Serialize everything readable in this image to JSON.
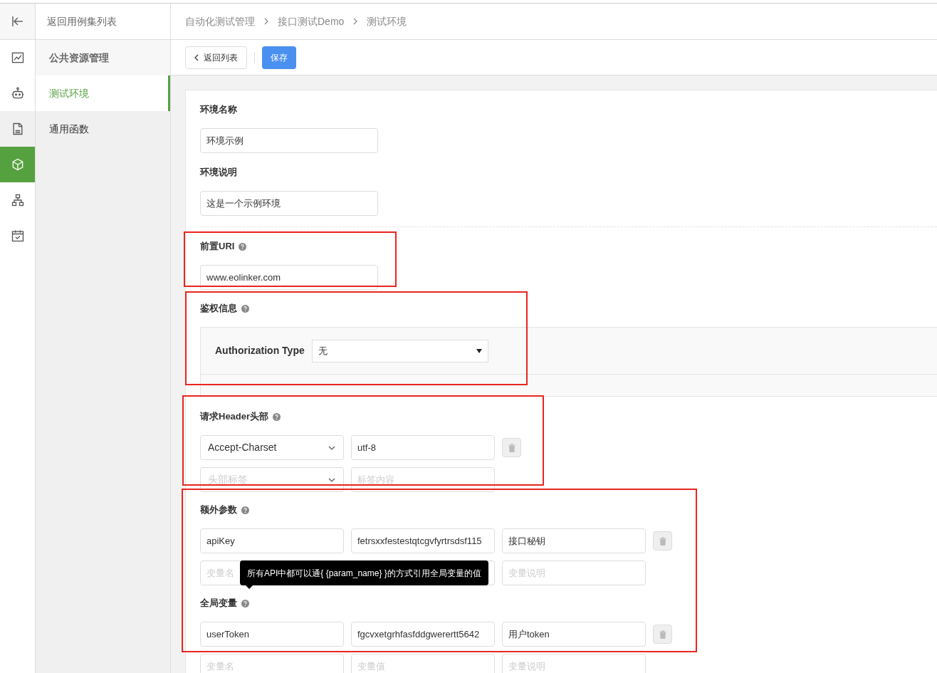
{
  "icon_nav": [
    {
      "selected": false,
      "hovered": false
    },
    {
      "selected": false,
      "hovered": false
    },
    {
      "selected": false,
      "hovered": true
    },
    {
      "selected": true,
      "hovered": false
    },
    {
      "selected": false,
      "hovered": false
    },
    {
      "selected": false,
      "hovered": false
    }
  ],
  "back_link": "返回用例集列表",
  "submenu": [
    {
      "label": "公共资源管理",
      "kind": "header"
    },
    {
      "label": "测试环境",
      "kind": "item",
      "selected": true
    },
    {
      "label": "通用函数",
      "kind": "item",
      "selected": false
    }
  ],
  "breadcrumb": [
    "自动化测试管理",
    "接口测试Demo",
    "测试环境"
  ],
  "toolbar": {
    "back_button": "返回列表",
    "save_button": "保存"
  },
  "form": {
    "env_name": {
      "label": "环境名称",
      "value": "环境示例"
    },
    "env_desc": {
      "label": "环境说明",
      "value": "这是一个示例环境"
    },
    "base_uri": {
      "label": "前置URI",
      "value": "www.eolinker.com"
    },
    "auth": {
      "label": "鉴权信息",
      "type_label": "Authorization Type",
      "type_value": "无"
    },
    "headers": {
      "label": "请求Header头部",
      "rows": [
        {
          "name": "Accept-Charset",
          "value": "utf-8",
          "removable": true
        },
        {
          "name_placeholder": "头部标签",
          "value_placeholder": "标签内容",
          "removable": false
        }
      ]
    },
    "extra_params": {
      "label": "额外参数",
      "rows": [
        {
          "name": "apiKey",
          "value": "fetrsxxfestestqtcgvfyrtrsdsf115",
          "desc": "接口秘钥",
          "removable": true
        },
        {
          "name_placeholder": "变量名",
          "desc_placeholder": "变量说明",
          "removable": false
        }
      ]
    },
    "global_vars": {
      "label": "全局变量",
      "tooltip": "所有API中都可以通{ {param_name} }的方式引用全局变量的值",
      "rows": [
        {
          "name": "userToken",
          "value": "fgcvxetgrhfasfddgwerertt5642",
          "desc": "用户token",
          "removable": true
        },
        {
          "name_placeholder": "变量名",
          "value_placeholder": "变量值",
          "desc_placeholder": "变量说明",
          "removable": false
        }
      ]
    }
  }
}
